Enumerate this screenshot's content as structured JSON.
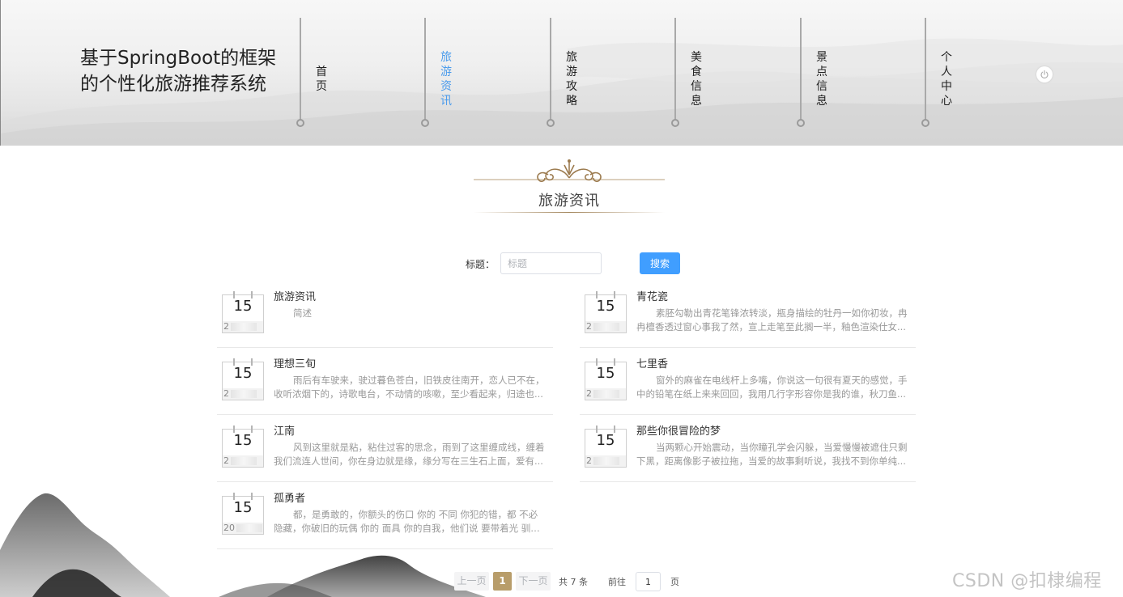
{
  "header": {
    "site_title": "基于SpringBoot的框架的个性化旅游推荐系统",
    "nav": [
      {
        "label": "首页",
        "active": false
      },
      {
        "label": "旅游资讯",
        "active": true
      },
      {
        "label": "旅游攻略",
        "active": false
      },
      {
        "label": "美食信息",
        "active": false
      },
      {
        "label": "景点信息",
        "active": false
      },
      {
        "label": "个人中心",
        "active": false
      }
    ],
    "logout_icon": "power-icon"
  },
  "section": {
    "title": "旅游资讯"
  },
  "search": {
    "label": "标题：",
    "placeholder": "标题",
    "button": "搜索"
  },
  "news": [
    {
      "title": "旅游资讯",
      "day": "15",
      "date_prefix": "2",
      "desc": "简述"
    },
    {
      "title": "青花瓷",
      "day": "15",
      "date_prefix": "2",
      "desc": "素胚勾勒出青花笔锋浓转淡，瓶身描绘的牡丹一如你初妆，冉冉檀香透过窗心事我了然，宣上走笔至此搁一半，釉色渲染仕女..."
    },
    {
      "title": "理想三旬",
      "day": "15",
      "date_prefix": "2",
      "desc": "雨后有车驶来，驶过暮色苍白，旧铁皮往南开，恋人已不在，收听浓烟下的，诗歌电台，不动情的咳嗽，至少看起来，归途也..."
    },
    {
      "title": "七里香",
      "day": "15",
      "date_prefix": "2",
      "desc": "窗外的麻雀在电线杆上多嘴，你说这一句很有夏天的感觉，手中的铅笔在纸上来来回回，我用几行字形容你是我的谁，秋刀鱼..."
    },
    {
      "title": "江南",
      "day": "15",
      "date_prefix": "2",
      "desc": "风到这里就是粘，粘住过客的思念，雨到了这里缠成线，缠着我们流连人世间，你在身边就是缘，缘分写在三生石上面，爱有..."
    },
    {
      "title": "那些你很冒险的梦",
      "day": "15",
      "date_prefix": "2",
      "desc": "当两颗心开始震动，当你瞳孔学会闪躲，当爱慢慢被遮住只剩下黑，距离像影子被拉拖，当爱的故事剩听说，我找不到你单纯..."
    },
    {
      "title": "孤勇者",
      "day": "15",
      "date_prefix": "20",
      "desc": "都，是勇敢的，你额头的伤口 你的 不同 你犯的错，都 不必隐藏，你破旧的玩偶 你的 面具 你的自我，他们说 要带着光 驯服每..."
    }
  ],
  "pagination": {
    "prev": "上一页",
    "current": "1",
    "next": "下一页",
    "total": "共 7 条",
    "goto_label": "前往",
    "goto_value": "1",
    "page_suffix": "页"
  },
  "watermark": "CSDN @扣棣编程",
  "colors": {
    "accent_blue": "#409eff",
    "nav_active": "#4a9bec",
    "pager_active": "#b89d6a",
    "ornament": "#a08257"
  }
}
